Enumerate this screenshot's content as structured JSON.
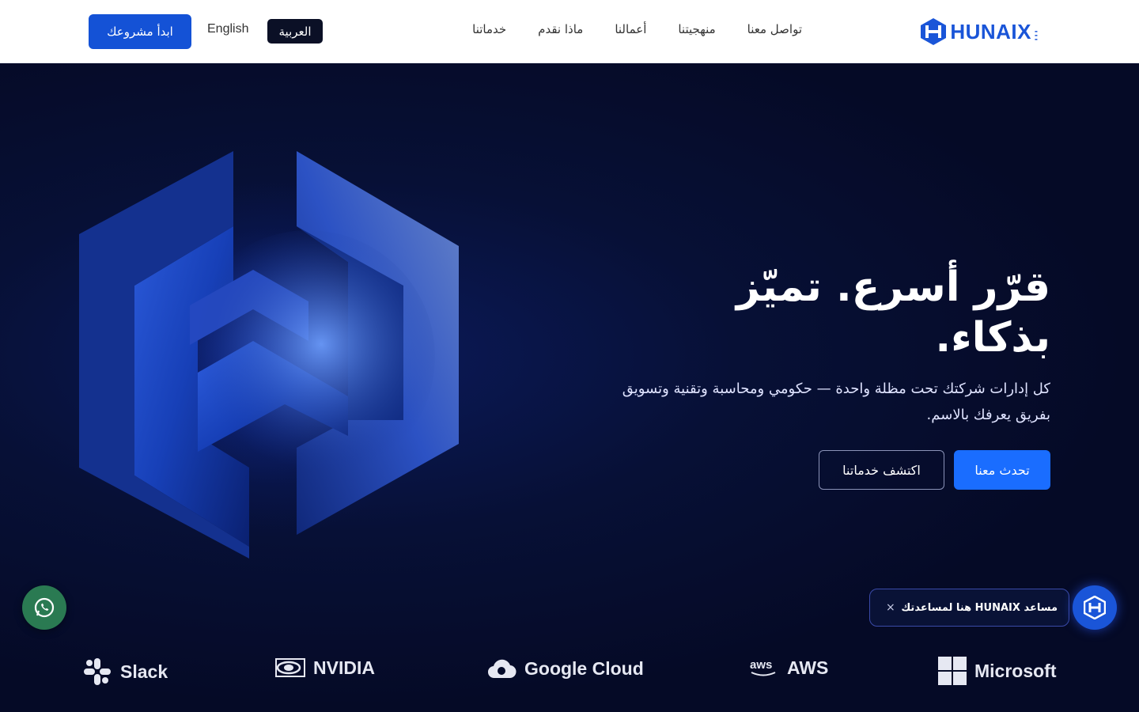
{
  "header": {
    "brand": "HUNAIX",
    "brand_tagline": "HUNAIX",
    "cta_label": "ابدأ مشروعك",
    "lang_en": "English",
    "lang_ar": "العربية",
    "nav": [
      "خدماتنا",
      "ماذا نقدم",
      "أعمالنا",
      "منهجيتنا",
      "تواصل معنا"
    ]
  },
  "hero": {
    "title": "قرّر أسرع. تميّز بذكاء.",
    "subtitle": "كل إدارات شركتك تحت مظلة واحدة — حكومي ومحاسبة وتقنية وتسويق بفريق يعرفك بالاسم.",
    "primary_button": "تحدث معنا",
    "secondary_button": "اكتشف خدماتنا"
  },
  "assistant": {
    "message": "مساعد HUNAIX هنا لمساعدتك",
    "close": "×"
  },
  "partners": [
    "Slack",
    "NVIDIA",
    "Google Cloud",
    "AWS",
    "Microsoft"
  ],
  "colors": {
    "accent": "#1a6dff",
    "brand": "#1a55d8",
    "hero_bg": "#050b2a",
    "whatsapp": "#2a7a52"
  }
}
